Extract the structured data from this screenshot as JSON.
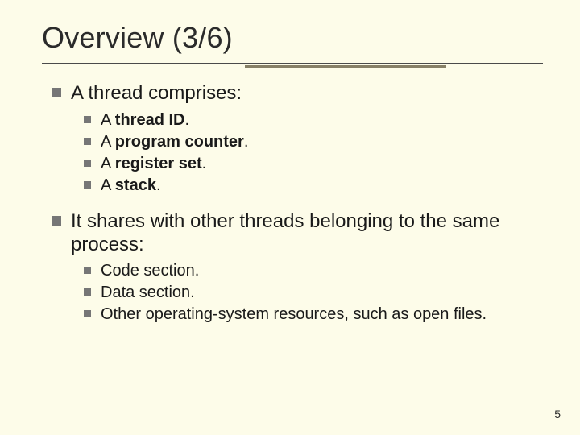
{
  "slide": {
    "title": "Overview (3/6)",
    "page_number": "5"
  },
  "bullets": {
    "b1": {
      "text": "A thread comprises:",
      "sub": [
        {
          "pre": "A ",
          "strong": "thread ID",
          "post": "."
        },
        {
          "pre": "A ",
          "strong": "program counter",
          "post": "."
        },
        {
          "pre": "A ",
          "strong": "register set",
          "post": "."
        },
        {
          "pre": "A ",
          "strong": "stack",
          "post": "."
        }
      ]
    },
    "b2": {
      "text": "It shares with other threads belonging to the same process:",
      "sub_plain": [
        "Code section.",
        "Data section.",
        "Other operating-system resources, such as open files."
      ]
    }
  }
}
